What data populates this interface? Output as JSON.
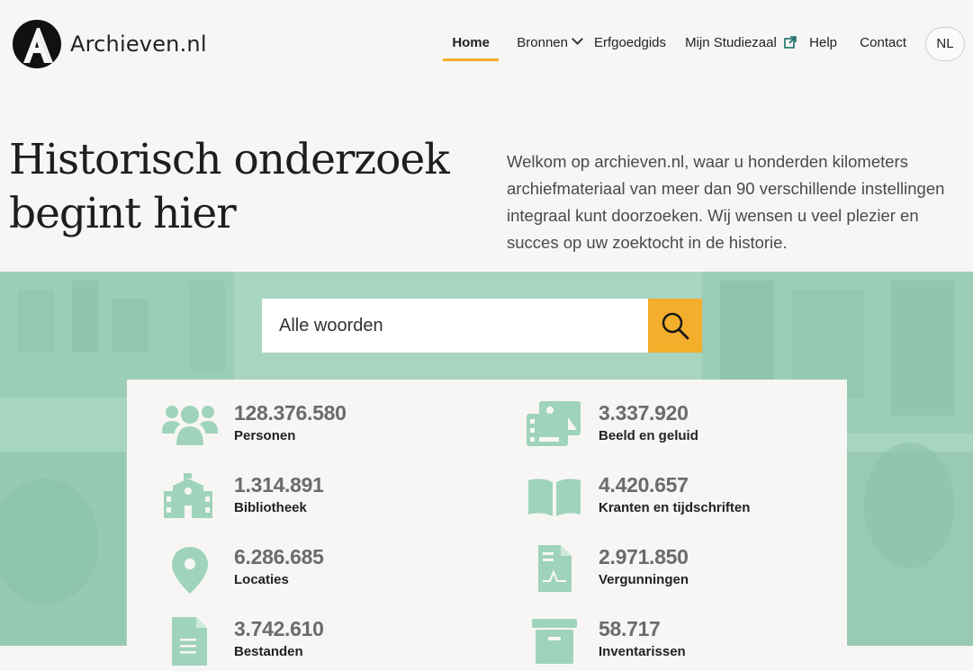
{
  "brand": {
    "name": "Archieven.nl"
  },
  "nav": {
    "home": "Home",
    "bronnen": "Bronnen",
    "erfgoedgids": "Erfgoedgids",
    "studiezaal": "Mijn Studiezaal",
    "help": "Help",
    "contact": "Contact",
    "language": "NL"
  },
  "hero": {
    "title": "Historisch onderzoek begint hier",
    "intro": "Welkom op archieven.nl, waar u honderden kilometers archiefmateriaal van meer dan 90 verschillende instellingen integraal kunt doorzoeken. Wij wensen u veel plezier en succes op uw zoektocht in de historie."
  },
  "search": {
    "placeholder": "Alle woorden",
    "value": ""
  },
  "stats": [
    {
      "count": "128.376.580",
      "label": "Personen",
      "icon": "people-icon"
    },
    {
      "count": "3.337.920",
      "label": "Beeld en geluid",
      "icon": "media-icon"
    },
    {
      "count": "1.314.891",
      "label": "Bibliotheek",
      "icon": "library-building-icon"
    },
    {
      "count": "4.420.657",
      "label": "Kranten en tijdschriften",
      "icon": "open-book-icon"
    },
    {
      "count": "6.286.685",
      "label": "Locaties",
      "icon": "map-pin-icon"
    },
    {
      "count": "2.971.850",
      "label": "Vergunningen",
      "icon": "permit-document-icon"
    },
    {
      "count": "3.742.610",
      "label": "Bestanden",
      "icon": "file-icon"
    },
    {
      "count": "58.717",
      "label": "Inventarissen",
      "icon": "archive-box-icon"
    }
  ],
  "colors": {
    "accent": "#f3ae2b",
    "mint": "#a9d6c2",
    "icon": "#9fd3bc"
  }
}
